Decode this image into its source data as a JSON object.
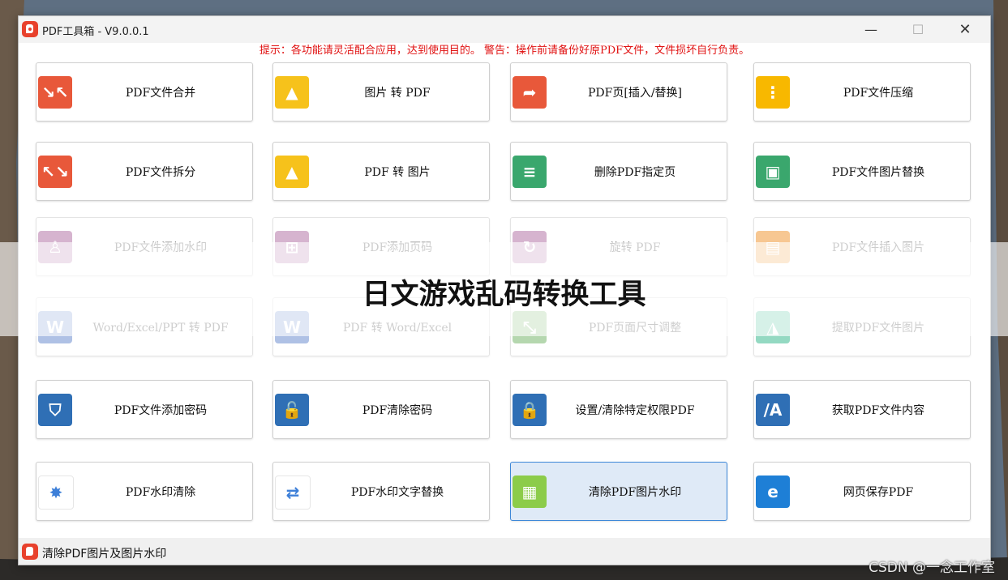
{
  "window": {
    "title": "PDF工具箱 - V9.0.0.1"
  },
  "window_controls": {
    "minimize": "—",
    "maximize": "☐",
    "close": "✕"
  },
  "notice": "提示：各功能请灵活配合应用，达到使用目的。 警告：操作前请备份好原PDF文件，文件损坏自行负责。",
  "tools": [
    {
      "label": "PDF文件合并",
      "icon": "merge-icon",
      "color": "#e8583a",
      "glyph": "↘↖"
    },
    {
      "label": "图片 转 PDF",
      "icon": "image-to-pdf-icon",
      "color": "#f6c21b",
      "glyph": "▲"
    },
    {
      "label": "PDF页[插入/替换]",
      "icon": "share-arrow-icon",
      "color": "#e8583a",
      "glyph": "➦"
    },
    {
      "label": "PDF文件压缩",
      "icon": "zip-icon",
      "color": "#f8b800",
      "glyph": "⋮"
    },
    {
      "label": "PDF文件拆分",
      "icon": "split-icon",
      "color": "#e8583a",
      "glyph": "↖↘"
    },
    {
      "label": "PDF 转 图片",
      "icon": "pdf-to-image-icon",
      "color": "#f6c21b",
      "glyph": "▲"
    },
    {
      "label": "删除PDF指定页",
      "icon": "delete-page-icon",
      "color": "#3aa76d",
      "glyph": "≡"
    },
    {
      "label": "PDF文件图片替换",
      "icon": "image-replace-icon",
      "color": "#3aa76d",
      "glyph": "▣"
    },
    {
      "label": "PDF文件添加水印",
      "icon": "stamp-icon",
      "color": "#b678a8",
      "glyph": "♙"
    },
    {
      "label": "PDF添加页码",
      "icon": "page-number-icon",
      "color": "#b678a8",
      "glyph": "⊞"
    },
    {
      "label": "旋转 PDF",
      "icon": "rotate-icon",
      "color": "#b678a8",
      "glyph": "↻"
    },
    {
      "label": "PDF文件插入图片",
      "icon": "insert-image-icon",
      "color": "#f29b3a",
      "glyph": "▤"
    },
    {
      "label": "Word/Excel/PPT 转 PDF",
      "icon": "office-to-pdf-icon",
      "color": "#6f8fd0",
      "glyph": "W"
    },
    {
      "label": "PDF 转 Word/Excel",
      "icon": "pdf-to-word-icon",
      "color": "#6f8fd0",
      "glyph": "W"
    },
    {
      "label": "PDF页面尺寸调整",
      "icon": "resize-icon",
      "color": "#7ab86e",
      "glyph": "⤡"
    },
    {
      "label": "提取PDF文件图片",
      "icon": "extract-image-icon",
      "color": "#3dbb92",
      "glyph": "◮"
    },
    {
      "label": "PDF文件添加密码",
      "icon": "shield-icon",
      "color": "#2f6fb5",
      "glyph": "⛉"
    },
    {
      "label": "PDF清除密码",
      "icon": "unlock-icon",
      "color": "#2f6fb5",
      "glyph": "🔓"
    },
    {
      "label": "设置/清除特定权限PDF",
      "icon": "lock-icon",
      "color": "#2f6fb5",
      "glyph": "🔒"
    },
    {
      "label": "获取PDF文件内容",
      "icon": "text-extract-icon",
      "color": "#2f6fb5",
      "glyph": "/A"
    },
    {
      "label": "PDF水印清除",
      "icon": "pinwheel-icon",
      "color": "#ffffff",
      "glyph": "✸"
    },
    {
      "label": "PDF水印文字替换",
      "icon": "text-replace-icon",
      "color": "#ffffff",
      "glyph": "⇄"
    },
    {
      "label": "清除PDF图片水印",
      "icon": "image-watermark-icon",
      "color": "#8ccc4a",
      "glyph": "▦"
    },
    {
      "label": "网页保存PDF",
      "icon": "browser-icon",
      "color": "#1e7fd6",
      "glyph": "e"
    }
  ],
  "overlay_title": "日文游戏乱码转换工具",
  "status": {
    "text": "清除PDF图片及图片水印"
  },
  "watermark": "CSDN @一念工作室"
}
